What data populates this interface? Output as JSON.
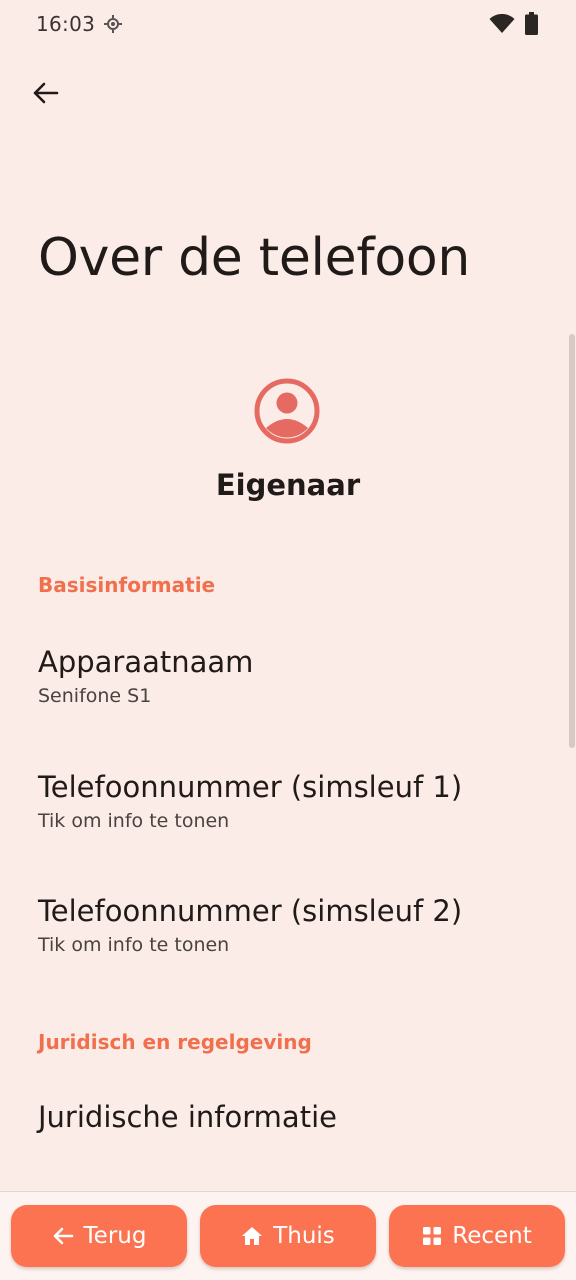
{
  "status": {
    "time": "16:03"
  },
  "header": {
    "title": "Over de telefoon"
  },
  "owner": {
    "name": "Eigenaar"
  },
  "sections": {
    "basic": {
      "header": "Basisinformatie",
      "items": [
        {
          "title": "Apparaatnaam",
          "subtitle": "Senifone S1"
        },
        {
          "title": "Telefoonnummer (simsleuf 1)",
          "subtitle": "Tik om info te tonen"
        },
        {
          "title": "Telefoonnummer (simsleuf 2)",
          "subtitle": "Tik om info te tonen"
        }
      ]
    },
    "legal": {
      "header": "Juridisch en regelgeving",
      "items": [
        {
          "title": "Juridische informatie"
        }
      ]
    }
  },
  "nav": {
    "back_label": "Terug",
    "home_label": "Thuis",
    "recent_label": "Recent"
  },
  "colors": {
    "background": "#fcece8",
    "accent": "#f0704e",
    "nav_button": "#fb7350",
    "avatar": "#e46a62"
  },
  "icons": {
    "location": "location-icon",
    "wifi": "wifi-icon",
    "battery": "battery-icon",
    "back": "arrow-left-icon",
    "avatar": "account-circle-icon",
    "home": "home-icon",
    "recent": "grid-icon"
  }
}
